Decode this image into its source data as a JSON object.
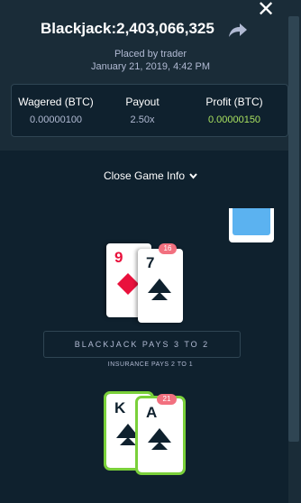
{
  "header": {
    "title": "Blackjack:2,403,066,325",
    "placed_by": "Placed by trader",
    "date": "January 21, 2019, 4:42 PM",
    "close_label": "✕"
  },
  "stats": {
    "wagered_label": "Wagered (BTC)",
    "wagered_value": "0.00000100",
    "payout_label": "Payout",
    "payout_value": "2.50x",
    "profit_label": "Profit (BTC)",
    "profit_value": "0.00000150"
  },
  "toggle_label": "Close Game Info",
  "dealer": {
    "score": "16",
    "cards": [
      {
        "rank": "9",
        "suit": "diamond",
        "color": "#e9113c"
      },
      {
        "rank": "7",
        "suit": "spade",
        "color": "#0f212e"
      }
    ]
  },
  "banner_text": "BLACKJACK PAYS 3 TO 2",
  "insurance_text": "INSURANCE PAYS 2 TO 1",
  "player": {
    "score": "21",
    "cards": [
      {
        "rank": "K",
        "suit": "spade",
        "color": "#0f212e"
      },
      {
        "rank": "A",
        "suit": "spade",
        "color": "#0f212e"
      }
    ]
  },
  "colors": {
    "accent_green": "#a8e05f",
    "badge": "#f2707f",
    "win_outline": "#7ad03a",
    "card_back": "#5bb2f0"
  }
}
